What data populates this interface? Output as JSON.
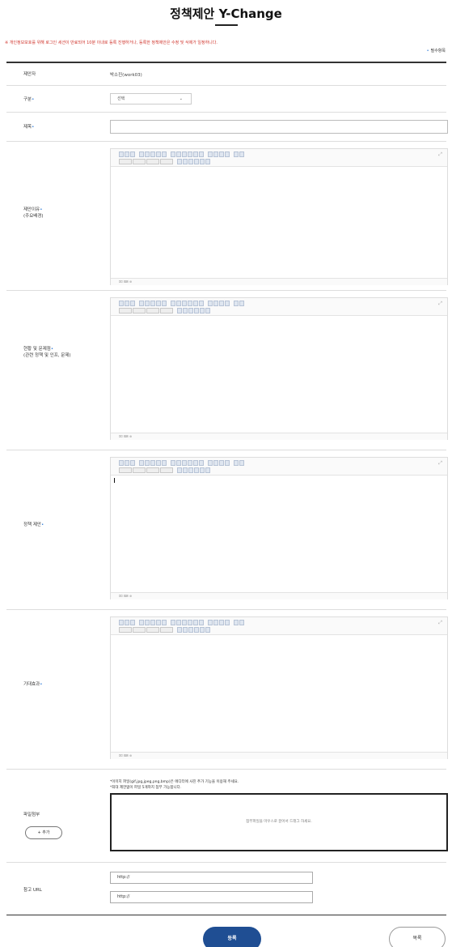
{
  "header": {
    "title": "정책제안 Y-Change"
  },
  "notice_text": "※ 개인정보보호를 위해 로그인 세션이 만료되어 10분 이내로 등록 진행하거나, 등록한 정책제안은 수정 및 삭제가 일정하니다.",
  "required_legend": {
    "dot": "•",
    "label": "필수항목"
  },
  "form": {
    "proposer": {
      "label": "제안자",
      "value": "박소진(work03)"
    },
    "category": {
      "label": "구분",
      "required_mark": "•",
      "selected": "선택",
      "chevron": "⌄"
    },
    "subject": {
      "label": "제목",
      "required_mark": "•",
      "value": ""
    },
    "background": {
      "label": "제안이유",
      "required_mark": "•",
      "sub_label": "(주요배경)",
      "status_text": "⌧ ⌨ ⊕"
    },
    "current_issues": {
      "label": "현황 및 문제점",
      "required_mark": "•",
      "sub_label": "(관련 정책 및 인프, 문제)",
      "status_text": "⌧ ⌨ ⊕"
    },
    "proposal": {
      "label": "정책 제안",
      "required_mark": "•",
      "status_text": "⌧ ⌨ ⊕"
    },
    "expected_effect": {
      "label": "기대효과",
      "required_mark": "•",
      "status_text": "⌧ ⌨ ⊕"
    },
    "attachment": {
      "label": "파일첨부",
      "add_label": "+ 추가",
      "note_line1": "*이미지 파일(gif,jpg,jpeg,png,bmp)은 에디터에 사진 추가 기능을 이용해 주세요.",
      "note_line2": "*최대 제한없이 파일 5개까지 첨부 가능합니다.",
      "dropzone_text": "첨부파일을 마우스로 끌어서 드래그 하세요."
    },
    "reference_url": {
      "label": "참고 URL",
      "url1": "http://",
      "url2": "http://"
    }
  },
  "buttons": {
    "register": "등록",
    "list": "목록"
  },
  "colors": {
    "primary": "#1f4e93",
    "required": "#2e7ad6",
    "notice": "#d0342c"
  }
}
